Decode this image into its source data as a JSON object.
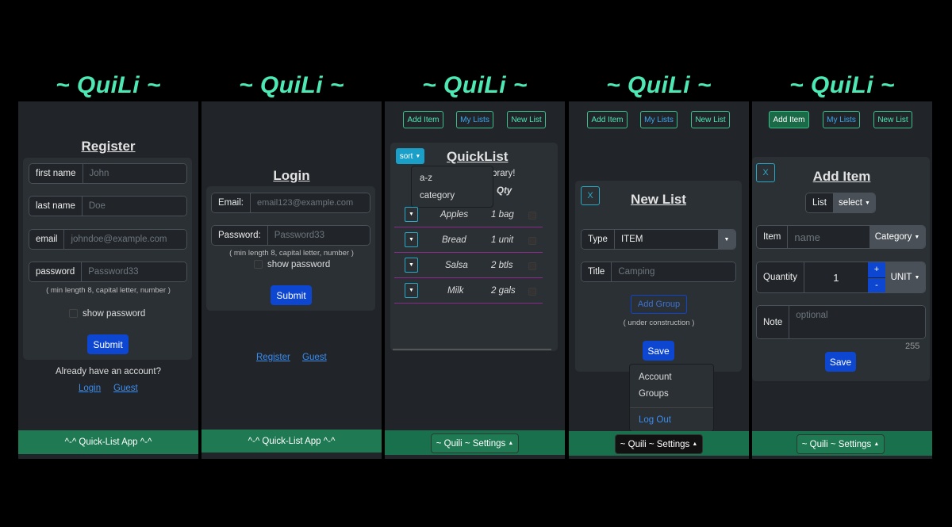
{
  "brand": "~ QuiLi ~",
  "register": {
    "title": "Register",
    "first_name_label": "first name",
    "first_name_placeholder": "John",
    "last_name_label": "last name",
    "last_name_placeholder": "Doe",
    "email_label": "email",
    "email_placeholder": "johndoe@example.com",
    "password_label": "password",
    "password_placeholder": "Password33",
    "password_hint": "( min length 8, capital letter, number )",
    "show_password": "show password",
    "submit": "Submit",
    "already": "Already have an account?",
    "login_link": "Login",
    "guest_link": "Guest",
    "footer": "^-^ Quick-List App ^-^"
  },
  "login": {
    "title": "Login",
    "email_label": "Email:",
    "email_placeholder": "email123@example.com",
    "password_label": "Password:",
    "password_placeholder": "Password33",
    "password_hint": "( min length 8, capital letter, number )",
    "show_password": "show password",
    "submit": "Submit",
    "register_link": "Register",
    "guest_link": "Guest",
    "footer": "^-^ Quick-List App ^-^"
  },
  "nav": {
    "add_item": "Add Item",
    "my_lists": "My Lists",
    "new_list": "New List"
  },
  "quicklist": {
    "title": "QuickList",
    "sort_button": "sort",
    "sort_options": [
      "a-z",
      "category"
    ],
    "subtitle_partial": "brary!",
    "qty_header": "Qty",
    "items": [
      {
        "name": "Apples",
        "qty": "1 bag"
      },
      {
        "name": "Bread",
        "qty": "1 unit"
      },
      {
        "name": "Salsa",
        "qty": "2 btls"
      },
      {
        "name": "Milk",
        "qty": "2 gals"
      }
    ],
    "settings": "~ Quili ~ Settings"
  },
  "newlist": {
    "close": "X",
    "title": "New List",
    "type_label": "Type",
    "type_value": "ITEM",
    "title_label": "Title",
    "title_placeholder": "Camping",
    "add_group": "Add Group",
    "under_construction": "( under construction )",
    "save": "Save",
    "menu": [
      "Account",
      "Groups",
      "Log Out"
    ],
    "settings": "~ Quili ~ Settings"
  },
  "additem": {
    "close": "X",
    "title": "Add Item",
    "list_label": "List",
    "list_select": "select",
    "item_label": "Item",
    "item_placeholder": "name",
    "category": "Category",
    "quantity_label": "Quantity",
    "quantity_value": "1",
    "plus": "+",
    "minus": "-",
    "unit": "UNIT",
    "note_label": "Note",
    "note_placeholder": "optional",
    "char_count": "255",
    "save": "Save",
    "settings": "~ Quili ~ Settings"
  },
  "colors": {
    "brand": "#4ee8b4",
    "primary": "#0d47d1",
    "footer": "#1f7a54",
    "row_border": "#8a2a8a",
    "info": "#1a9fc9"
  }
}
